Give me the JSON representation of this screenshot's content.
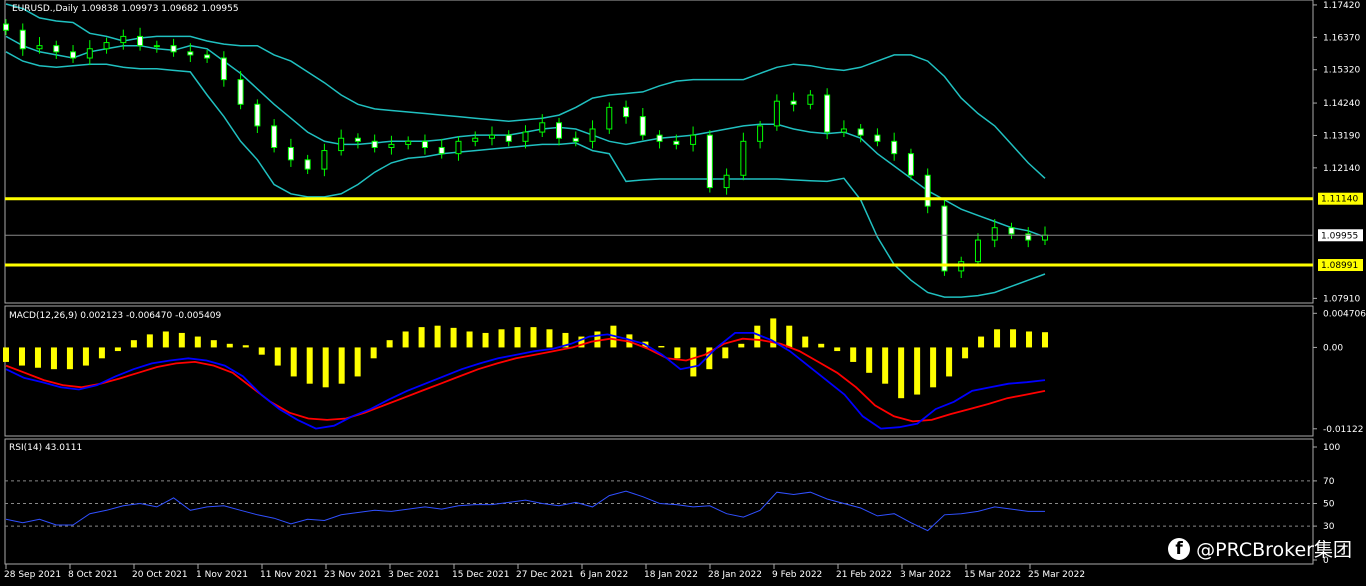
{
  "chart_data": {
    "type": "candlestick",
    "symbol_label": "EURUSD.,Daily",
    "ohlc_label": "1.09838 1.09973 1.09682 1.09955",
    "price_axis": {
      "ylim": [
        1.0776,
        1.1758
      ],
      "ticks": [
        "1.17420",
        "1.16370",
        "1.15320",
        "1.14240",
        "1.13190",
        "1.12140",
        "1.07910"
      ]
    },
    "horizontal_lines": [
      {
        "label": "1.11140",
        "value": 1.1114,
        "color": "#ffff00"
      },
      {
        "label": "1.08991",
        "value": 1.08991,
        "color": "#ffff00"
      }
    ],
    "last_price": {
      "label": "1.09955",
      "value": 1.09955
    },
    "bollinger": {
      "color": "#20c0c0",
      "upper": [
        1.1745,
        1.173,
        1.17,
        1.169,
        1.1685,
        1.165,
        1.164,
        1.1625,
        1.1635,
        1.164,
        1.164,
        1.164,
        1.1625,
        1.1615,
        1.161,
        1.161,
        1.158,
        1.156,
        1.1525,
        1.149,
        1.145,
        1.142,
        1.1405,
        1.14,
        1.1395,
        1.139,
        1.1385,
        1.138,
        1.1375,
        1.137,
        1.1365,
        1.137,
        1.1375,
        1.1385,
        1.141,
        1.144,
        1.145,
        1.1455,
        1.146,
        1.148,
        1.1495,
        1.15,
        1.15,
        1.15,
        1.15,
        1.152,
        1.154,
        1.155,
        1.1545,
        1.1535,
        1.153,
        1.154,
        1.156,
        1.158,
        1.158,
        1.156,
        1.151,
        1.144,
        1.139,
        1.135,
        1.129,
        1.123,
        1.118
      ],
      "middle": [
        1.164,
        1.161,
        1.159,
        1.158,
        1.157,
        1.159,
        1.16,
        1.161,
        1.161,
        1.16,
        1.1595,
        1.161,
        1.16,
        1.156,
        1.152,
        1.147,
        1.142,
        1.1375,
        1.133,
        1.13,
        1.129,
        1.129,
        1.1295,
        1.13,
        1.13,
        1.13,
        1.1305,
        1.1315,
        1.132,
        1.132,
        1.132,
        1.133,
        1.134,
        1.1345,
        1.134,
        1.132,
        1.13,
        1.129,
        1.13,
        1.131,
        1.1315,
        1.132,
        1.133,
        1.134,
        1.135,
        1.1355,
        1.1355,
        1.134,
        1.133,
        1.1325,
        1.133,
        1.131,
        1.126,
        1.122,
        1.118,
        1.114,
        1.111,
        1.108,
        1.106,
        1.104,
        1.102,
        1.101,
        1.099
      ],
      "lower": [
        1.159,
        1.156,
        1.1545,
        1.154,
        1.1545,
        1.155,
        1.155,
        1.154,
        1.1535,
        1.1535,
        1.153,
        1.1525,
        1.145,
        1.138,
        1.13,
        1.124,
        1.116,
        1.113,
        1.112,
        1.112,
        1.113,
        1.116,
        1.12,
        1.123,
        1.1245,
        1.125,
        1.126,
        1.1265,
        1.127,
        1.1275,
        1.128,
        1.1285,
        1.129,
        1.129,
        1.1295,
        1.127,
        1.126,
        1.117,
        1.1175,
        1.1178,
        1.1178,
        1.1178,
        1.1178,
        1.1178,
        1.1178,
        1.1178,
        1.1178,
        1.1175,
        1.1172,
        1.117,
        1.118,
        1.111,
        1.099,
        1.09,
        1.085,
        1.081,
        1.0795,
        1.0795,
        1.08,
        1.081,
        1.083,
        1.085,
        1.087
      ]
    },
    "candles_close": [
      1.166,
      1.16,
      1.161,
      1.159,
      1.157,
      1.16,
      1.162,
      1.164,
      1.161,
      1.161,
      1.159,
      1.158,
      1.157,
      1.15,
      1.142,
      1.135,
      1.128,
      1.124,
      1.121,
      1.127,
      1.131,
      1.13,
      1.128,
      1.129,
      1.13,
      1.128,
      1.126,
      1.13,
      1.131,
      1.132,
      1.13,
      1.133,
      1.136,
      1.131,
      1.13,
      1.134,
      1.141,
      1.138,
      1.132,
      1.13,
      1.129,
      1.132,
      1.115,
      1.119,
      1.13,
      1.135,
      1.143,
      1.142,
      1.145,
      1.133,
      1.134,
      1.132,
      1.13,
      1.126,
      1.119,
      1.109,
      1.088,
      1.091,
      1.098,
      1.102,
      1.1,
      1.098,
      1.0996
    ],
    "x_tick_labels": [
      "28 Sep 2021",
      "8 Oct 2021",
      "20 Oct 2021",
      "1 Nov 2021",
      "11 Nov 2021",
      "23 Nov 2021",
      "3 Dec 2021",
      "15 Dec 2021",
      "27 Dec 2021",
      "6 Jan 2022",
      "18 Jan 2022",
      "28 Jan 2022",
      "9 Feb 2022",
      "21 Feb 2022",
      "3 Mar 2022",
      "15 Mar 2022",
      "25 Mar 2022"
    ],
    "macd": {
      "label": "MACD(12,26,9) 0.002123 -0.006470 -0.005409",
      "ylim": [
        -0.0118,
        0.0053
      ],
      "ticks": [
        "0.004706",
        "0.00",
        "-0.01122"
      ],
      "histogram_color": "#ffff00",
      "macd_line_color": "#0000ff",
      "signal_line_color": "#ff0000",
      "histogram": [
        -0.002,
        -0.0025,
        -0.0028,
        -0.003,
        -0.003,
        -0.0025,
        -0.0015,
        -0.0005,
        0.001,
        0.0018,
        0.0022,
        0.002,
        0.0015,
        0.001,
        0.0005,
        0.0003,
        -0.001,
        -0.0025,
        -0.004,
        -0.005,
        -0.0055,
        -0.005,
        -0.004,
        -0.0015,
        0.001,
        0.0022,
        0.0028,
        0.003,
        0.0027,
        0.0022,
        0.002,
        0.0025,
        0.0028,
        0.0028,
        0.0025,
        0.002,
        0.0015,
        0.0022,
        0.003,
        0.0018,
        0.0008,
        0.0002,
        -0.0015,
        -0.004,
        -0.003,
        -0.0015,
        0.0005,
        0.003,
        0.004,
        0.003,
        0.0015,
        0.0005,
        -0.0005,
        -0.002,
        -0.0035,
        -0.005,
        -0.007,
        -0.0065,
        -0.0055,
        -0.004,
        -0.0015,
        0.0015,
        0.0025,
        0.0025,
        0.0022,
        0.0021
      ],
      "macd_line": [
        -0.003,
        -0.0042,
        -0.0048,
        -0.0055,
        -0.0058,
        -0.0052,
        -0.004,
        -0.003,
        -0.0022,
        -0.0018,
        -0.0015,
        -0.0018,
        -0.0025,
        -0.004,
        -0.0065,
        -0.0085,
        -0.01,
        -0.0112,
        -0.0108,
        -0.0095,
        -0.0085,
        -0.0072,
        -0.006,
        -0.005,
        -0.004,
        -0.003,
        -0.0022,
        -0.0015,
        -0.001,
        -0.0005,
        -0.0002,
        0.0005,
        0.0015,
        0.0018,
        0.0012,
        0.0005,
        -0.001,
        -0.003,
        -0.0025,
        0.0,
        0.002,
        0.002,
        0.001,
        -0.0005,
        -0.0025,
        -0.0045,
        -0.0065,
        -0.0095,
        -0.0112,
        -0.011,
        -0.0105,
        -0.0085,
        -0.0075,
        -0.006,
        -0.0055,
        -0.005,
        -0.0048,
        -0.0045
      ],
      "signal_line": [
        -0.0025,
        -0.0035,
        -0.0045,
        -0.0052,
        -0.0055,
        -0.005,
        -0.0043,
        -0.0035,
        -0.0027,
        -0.0022,
        -0.002,
        -0.0025,
        -0.0035,
        -0.0055,
        -0.0075,
        -0.009,
        -0.0098,
        -0.01,
        -0.0098,
        -0.009,
        -0.008,
        -0.007,
        -0.006,
        -0.005,
        -0.004,
        -0.003,
        -0.0022,
        -0.0015,
        -0.001,
        -0.0005,
        0.0,
        0.0008,
        0.0012,
        0.0008,
        -0.0002,
        -0.0015,
        -0.0018,
        -0.001,
        0.0005,
        0.0012,
        0.001,
        0.0005,
        -0.0005,
        -0.002,
        -0.0035,
        -0.0055,
        -0.008,
        -0.0095,
        -0.0102,
        -0.01,
        -0.0092,
        -0.0085,
        -0.0078,
        -0.007,
        -0.0065,
        -0.006
      ]
    },
    "rsi": {
      "label": "RSI(14) 43.0111",
      "ylim": [
        0,
        100
      ],
      "ticks": [
        "100",
        "70",
        "50",
        "30",
        "0"
      ],
      "line_color": "#3050ff",
      "values": [
        36,
        33,
        36,
        31,
        31,
        41,
        44,
        48,
        50,
        47,
        55,
        44,
        47,
        48,
        44,
        40,
        37,
        32,
        36,
        35,
        40,
        42,
        44,
        43,
        45,
        47,
        45,
        48,
        49,
        49,
        51,
        53,
        50,
        48,
        51,
        47,
        57,
        61,
        56,
        50,
        49,
        47,
        48,
        41,
        38,
        44,
        60,
        58,
        60,
        54,
        50,
        46,
        39,
        41,
        33,
        26,
        40,
        41,
        43,
        47,
        45,
        43,
        43
      ]
    }
  },
  "watermark": {
    "text": "@PRCBroker集团",
    "icon": "facebook-icon"
  }
}
